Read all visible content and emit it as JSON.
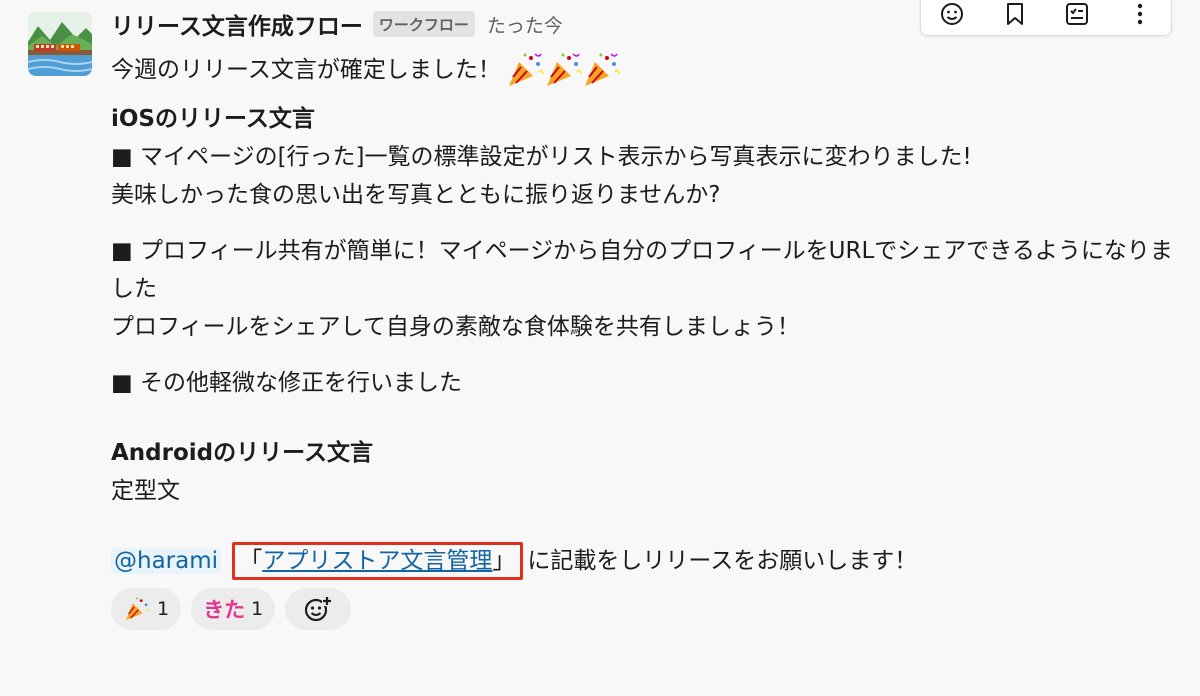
{
  "sender": {
    "name": "リリース文言作成フロー",
    "tag": "ワークフロー",
    "timestamp": "たった今"
  },
  "toolbar": {
    "icons": [
      "emoji-icon",
      "bookmark-icon",
      "checklist-icon",
      "more-icon"
    ]
  },
  "message": {
    "intro": "今週のリリース文言が確定しました！",
    "ios_heading": "iOSのリリース文言",
    "ios_item1_line1": "■ マイページの[行った]一覧の標準設定がリスト表示から写真表示に変わりました!",
    "ios_item1_line2": "美味しかった食の思い出を写真とともに振り返りませんか?",
    "ios_item2_line1": "■ プロフィール共有が簡単に！マイページから自分のプロフィールをURLでシェアできるようになりました",
    "ios_item2_line2": "プロフィールをシェアして自身の素敵な食体験を共有しましょう！",
    "ios_item3": "■ その他軽微な修正を行いました",
    "android_heading": "Androidのリリース文言",
    "android_body": "定型文",
    "mention": "@harami",
    "open_bracket": "「",
    "link_text": "アプリストア文言管理",
    "close_bracket": "」",
    "closing": "に記載をしリリースをお願いします！"
  },
  "reactions": [
    {
      "emoji": "party-popper",
      "count": "1"
    },
    {
      "emoji": "kita",
      "label": "きた",
      "count": "1"
    }
  ],
  "colors": {
    "link": "#1264a3",
    "highlight_border": "#e0301e",
    "kita": "#e8338b",
    "background": "#f8f8f8"
  }
}
